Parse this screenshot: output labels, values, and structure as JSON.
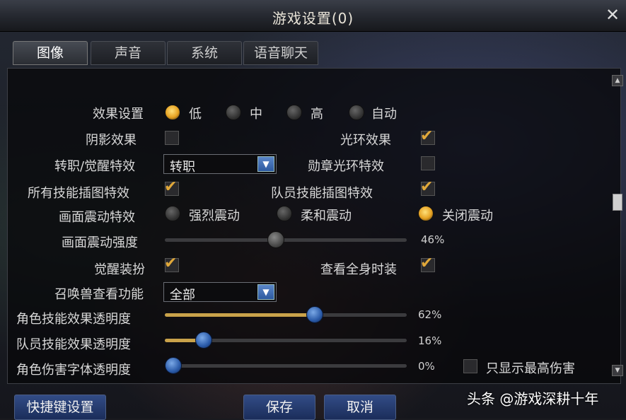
{
  "window": {
    "title": "游戏设置(0)",
    "close": "✕"
  },
  "tabs": [
    "图像",
    "声音",
    "系统",
    "语音聊天"
  ],
  "settings": {
    "effect": {
      "label": "效果设置",
      "options": [
        "低",
        "中",
        "高",
        "自动"
      ],
      "selected": "低"
    },
    "shadow": {
      "label": "阴影效果",
      "checked": false
    },
    "halo": {
      "label": "光环效果",
      "checked": true
    },
    "job_effect": {
      "label": "转职/觉醒特效",
      "value": "转职"
    },
    "medal_halo": {
      "label": "勋章光环特效",
      "checked": false
    },
    "all_skill_art": {
      "label": "所有技能插图特效",
      "checked": true
    },
    "party_skill_art": {
      "label": "队员技能插图特效",
      "checked": true
    },
    "shake": {
      "label": "画面震动特效",
      "options": [
        "强烈震动",
        "柔和震动",
        "关闭震动"
      ],
      "selected": "关闭震动"
    },
    "shake_strength": {
      "label": "画面震动强度",
      "value": 46,
      "display": "46%"
    },
    "awaken_costume": {
      "label": "觉醒装扮",
      "checked": true
    },
    "full_avatar": {
      "label": "查看全身时装",
      "checked": true
    },
    "summon_view": {
      "label": "召唤兽查看功能",
      "value": "全部"
    },
    "char_skill_alpha": {
      "label": "角色技能效果透明度",
      "value": 62,
      "display": "62%"
    },
    "party_skill_alpha": {
      "label": "队员技能效果透明度",
      "value": 16,
      "display": "16%"
    },
    "char_damage_alpha": {
      "label": "角色伤害字体透明度",
      "value": 0,
      "display": "0%"
    },
    "max_damage_only": {
      "label": "只显示最高伤害",
      "checked": false
    }
  },
  "buttons": {
    "shortcut": "快捷键设置",
    "save": "保存",
    "cancel": "取消"
  },
  "watermark": "头条 @游戏深耕十年",
  "colors": {
    "accent": "#e0a83a",
    "button": "#324c86",
    "slider_fill": "#c9a24a"
  }
}
